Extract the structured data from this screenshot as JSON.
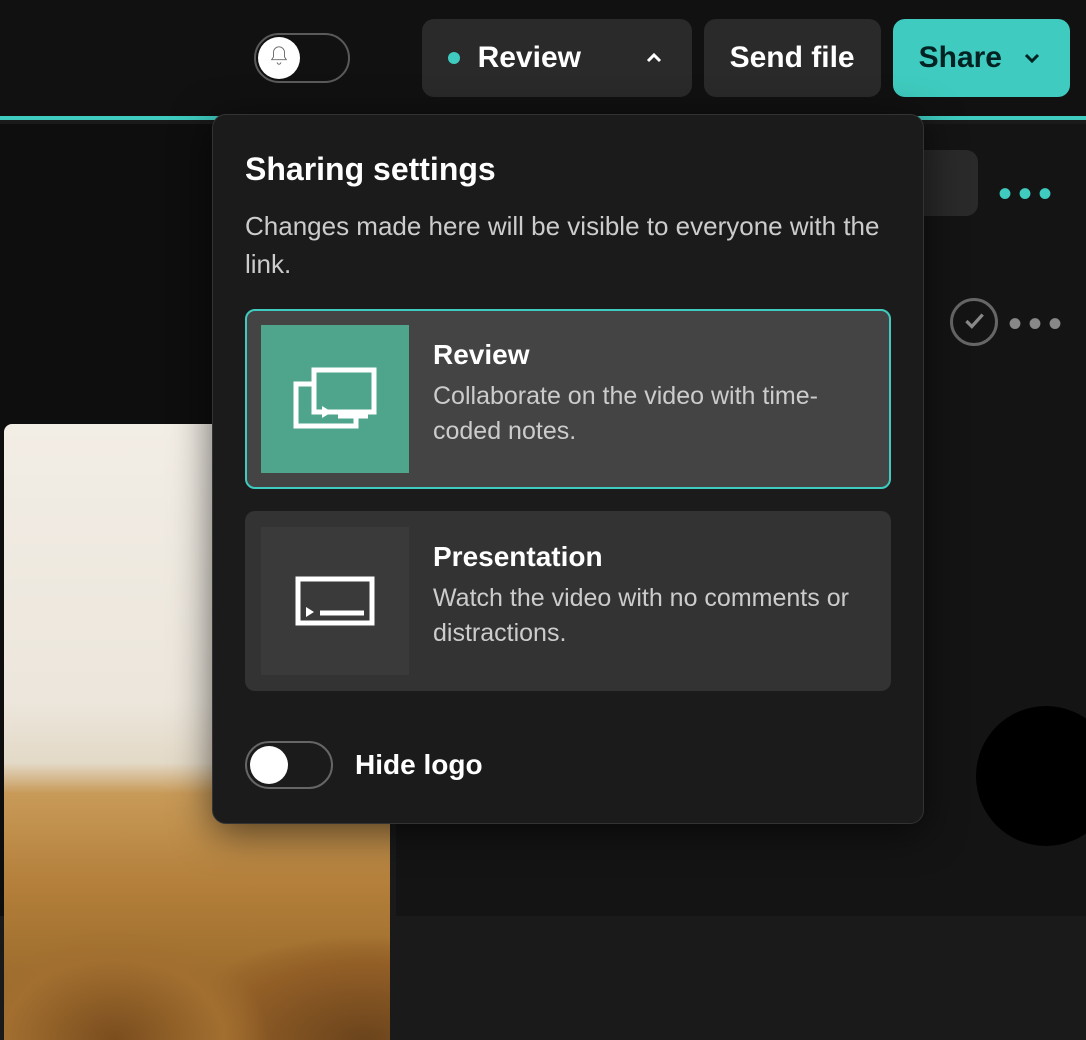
{
  "toolbar": {
    "review_label": "Review",
    "send_file_label": "Send file",
    "share_label": "Share"
  },
  "popup": {
    "title": "Sharing settings",
    "description": "Changes made here will be visible to everyone with the link.",
    "options": [
      {
        "title": "Review",
        "desc": "Collaborate on the video with time-coded notes.",
        "selected": true
      },
      {
        "title": "Presentation",
        "desc": "Watch the video with no comments or distractions.",
        "selected": false
      }
    ],
    "hide_logo_label": "Hide logo",
    "hide_logo_on": false
  },
  "colors": {
    "accent": "#3fcbbf"
  }
}
